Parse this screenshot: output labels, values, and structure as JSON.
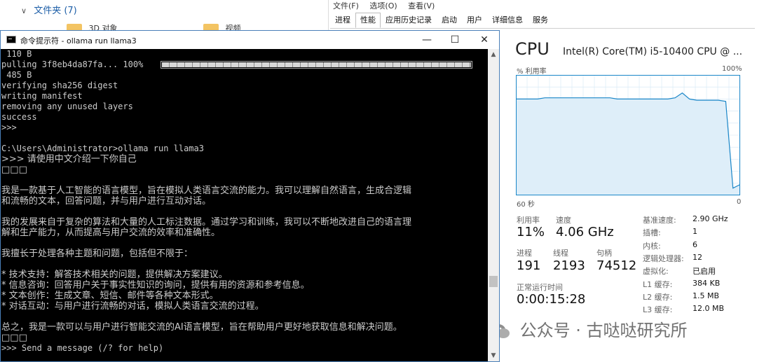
{
  "explorer": {
    "folders_header": "文件夹 (7)",
    "folder_items": [
      {
        "label": "3D 对象"
      },
      {
        "label": "视频"
      }
    ]
  },
  "taskmgr": {
    "menu": [
      "文件(F)",
      "选项(O)",
      "查看(V)"
    ],
    "tabs": [
      "进程",
      "性能",
      "应用历史记录",
      "启动",
      "用户",
      "详细信息",
      "服务"
    ],
    "active_tab": "性能",
    "cpu": {
      "title": "CPU",
      "model": "Intel(R) Core(TM) i5-10400 CPU @ ...",
      "util_label": "% 利用率",
      "pct_max": "100%",
      "time_span": "60 秒",
      "time_zero": "0",
      "graph_utilization_series_pct": [
        80,
        80,
        80,
        80,
        81,
        81,
        81,
        81,
        81,
        81,
        81,
        81,
        81,
        81,
        80,
        80,
        80,
        80,
        80,
        80,
        80,
        80,
        81,
        85,
        80,
        79,
        79,
        79,
        79,
        78,
        6,
        9
      ]
    },
    "stats": {
      "util_label": "利用率",
      "util_value": "11%",
      "speed_label": "速度",
      "speed_value": "4.06 GHz",
      "proc_label": "进程",
      "proc_value": "191",
      "threads_label": "线程",
      "threads_value": "2193",
      "handles_label": "句柄",
      "handles_value": "74512",
      "uptime_label": "正常运行时间",
      "uptime_value": "0:00:15:28"
    },
    "specs": [
      {
        "key": "基准速度:",
        "value": "2.90 GHz"
      },
      {
        "key": "插槽:",
        "value": "1"
      },
      {
        "key": "内核:",
        "value": "6"
      },
      {
        "key": "逻辑处理器:",
        "value": "12"
      },
      {
        "key": "虚拟化:",
        "value": "已启用"
      },
      {
        "key": "L1 缓存:",
        "value": "384 KB"
      },
      {
        "key": "L2 缓存:",
        "value": "1.5 MB"
      },
      {
        "key": "L3 缓存:",
        "value": "12.0 MB"
      }
    ],
    "colors": {
      "graph_line": "#1a86c8",
      "graph_fill": "#deeef9",
      "graph_grid": "#d2e6f4"
    }
  },
  "cmd": {
    "title": "命令提示符 - ollama  run llama3",
    "minimize": "—",
    "maximize": "☐",
    "close": "✕",
    "progress_pct": 100,
    "lines": [
      " 110 B",
      "pulling 3f8eb4da87fa... 100%",
      " 485 B",
      "verifying sha256 digest",
      "writing manifest",
      "removing any unused layers",
      "success",
      ">>>",
      "",
      "C:\\Users\\Administrator>ollama run llama3",
      ">>> 请使用中文介绍一下你自己",
      "□□□",
      "",
      "我是一款基于人工智能的语言模型，旨在模拟人类语言交流的能力。我可以理解自然语言，生成合逻辑",
      "和流畅的文本，回答问题，并与用户进行互动对话。",
      "",
      "我的发展来自于复杂的算法和大量的人工标注数据。通过学习和训练，我可以不断地改进自己的语言理",
      "解和生产能力，从而提高与用户交流的效率和准确性。",
      "",
      "我擅长于处理各种主题和问题，包括但不限于：",
      "",
      "* 技术支持：解答技术相关的问题，提供解决方案建议。",
      "* 信息咨询：回答用户关于事实性知识的询问，提供有用的资源和参考信息。",
      "* 文本创作：生成文章、短信、邮件等各种文本形式。",
      "* 对话互动：与用户进行流畅的对话，模拟人类语言交流的过程。",
      "",
      "总之，我是一款可以与用户进行智能交流的AI语言模型，旨在帮助用户更好地获取信息和解决问题。",
      "□□□",
      ">>> Send a message (/? for help)"
    ]
  },
  "watermark": "公众号 · 古哒哒研究所"
}
